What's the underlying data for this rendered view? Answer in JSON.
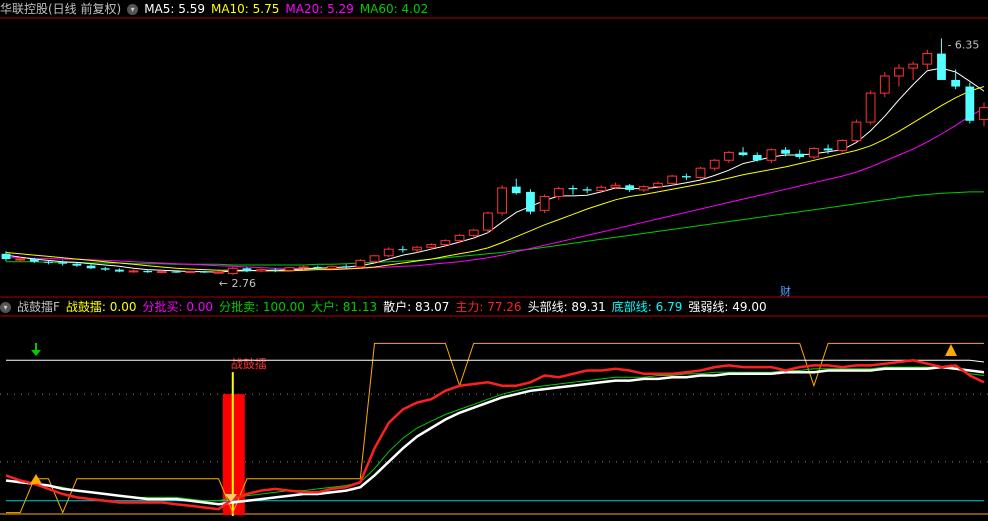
{
  "top_header": {
    "title": "华联控股(日线 前复权)",
    "items": [
      {
        "label": "MA5: 5.59",
        "color": "#ffffff"
      },
      {
        "label": "MA10: 5.75",
        "color": "#ffff00"
      },
      {
        "label": "MA20: 5.29",
        "color": "#ff00ff"
      },
      {
        "label": "MA60: 4.02",
        "color": "#00cc00"
      }
    ]
  },
  "bottom_header": {
    "title": "战鼓擂F",
    "items": [
      {
        "label": "战鼓擂: 0.00",
        "color": "#ffff00"
      },
      {
        "label": "分批买: 0.00",
        "color": "#ff00ff"
      },
      {
        "label": "分批卖: 100.00",
        "color": "#00cc00"
      },
      {
        "label": "大户: 81.13",
        "color": "#00cc00"
      },
      {
        "label": "散户: 83.07",
        "color": "#ffffff"
      },
      {
        "label": "主力: 77.26",
        "color": "#ff2020"
      },
      {
        "label": "头部线: 89.31",
        "color": "#ffffff"
      },
      {
        "label": "底部线: 6.79",
        "color": "#00ffff"
      },
      {
        "label": "强弱线: 49.00",
        "color": "#ffffff"
      }
    ]
  },
  "annotations": {
    "high_label": "6.35",
    "low_label": "2.76",
    "cai_marker": "财",
    "signal_label": "战鼓擂"
  },
  "colors": {
    "up": "#ff3232",
    "down": "#54ffff",
    "ma5": "#ffffff",
    "ma10": "#ffff00",
    "ma20": "#ff00ff",
    "ma60": "#00cc00",
    "panel_border": "#b00000"
  },
  "chart_data": [
    {
      "type": "candlestick",
      "title": "华联控股(日线 前复权)",
      "x": [
        "1",
        "2",
        "3",
        "4",
        "5",
        "6",
        "7",
        "8",
        "9",
        "10",
        "11",
        "12",
        "13",
        "14",
        "15",
        "16",
        "17",
        "18",
        "19",
        "20",
        "21",
        "22",
        "23",
        "24",
        "25",
        "26",
        "27",
        "28",
        "29",
        "30",
        "31",
        "32",
        "33",
        "34",
        "35",
        "36",
        "37",
        "38",
        "39",
        "40",
        "41",
        "42",
        "43",
        "44",
        "45",
        "46",
        "47",
        "48",
        "49",
        "50",
        "51",
        "52",
        "53",
        "54",
        "55",
        "56",
        "57",
        "58",
        "59",
        "60",
        "61",
        "62",
        "63",
        "64",
        "65",
        "66",
        "67",
        "68",
        "69",
        "70"
      ],
      "ohlc": [
        [
          3.08,
          3.12,
          2.97,
          3.0
        ],
        [
          3.0,
          3.04,
          2.96,
          3.0
        ],
        [
          3.0,
          3.02,
          2.94,
          2.96
        ],
        [
          2.96,
          2.98,
          2.92,
          2.95
        ],
        [
          2.95,
          2.98,
          2.9,
          2.93
        ],
        [
          2.93,
          2.95,
          2.88,
          2.9
        ],
        [
          2.9,
          2.92,
          2.85,
          2.86
        ],
        [
          2.86,
          2.88,
          2.82,
          2.84
        ],
        [
          2.84,
          2.86,
          2.8,
          2.81
        ],
        [
          2.81,
          2.84,
          2.79,
          2.82
        ],
        [
          2.82,
          2.84,
          2.79,
          2.8
        ],
        [
          2.8,
          2.83,
          2.79,
          2.81
        ],
        [
          2.81,
          2.83,
          2.79,
          2.8
        ],
        [
          2.8,
          2.82,
          2.79,
          2.81
        ],
        [
          2.81,
          2.82,
          2.79,
          2.8
        ],
        [
          2.8,
          2.82,
          2.79,
          2.8
        ],
        [
          2.78,
          2.88,
          2.76,
          2.86
        ],
        [
          2.86,
          2.88,
          2.8,
          2.82
        ],
        [
          2.82,
          2.86,
          2.8,
          2.84
        ],
        [
          2.84,
          2.86,
          2.8,
          2.83
        ],
        [
          2.83,
          2.88,
          2.82,
          2.87
        ],
        [
          2.87,
          2.9,
          2.84,
          2.88
        ],
        [
          2.88,
          2.9,
          2.85,
          2.86
        ],
        [
          2.86,
          2.9,
          2.84,
          2.89
        ],
        [
          2.89,
          2.92,
          2.86,
          2.88
        ],
        [
          2.88,
          3.0,
          2.86,
          2.98
        ],
        [
          2.96,
          3.06,
          2.94,
          3.05
        ],
        [
          3.05,
          3.18,
          3.03,
          3.15
        ],
        [
          3.15,
          3.2,
          3.1,
          3.14
        ],
        [
          3.14,
          3.2,
          3.1,
          3.18
        ],
        [
          3.18,
          3.24,
          3.14,
          3.22
        ],
        [
          3.22,
          3.3,
          3.18,
          3.28
        ],
        [
          3.28,
          3.38,
          3.24,
          3.36
        ],
        [
          3.36,
          3.46,
          3.3,
          3.44
        ],
        [
          3.44,
          3.72,
          3.4,
          3.7
        ],
        [
          3.7,
          4.12,
          3.66,
          4.08
        ],
        [
          4.1,
          4.22,
          3.98,
          4.0
        ],
        [
          4.02,
          4.06,
          3.68,
          3.72
        ],
        [
          3.74,
          3.98,
          3.7,
          3.95
        ],
        [
          3.95,
          4.1,
          3.9,
          4.07
        ],
        [
          4.08,
          4.12,
          3.98,
          4.06
        ],
        [
          4.06,
          4.1,
          4.0,
          4.04
        ],
        [
          4.04,
          4.12,
          4.02,
          4.09
        ],
        [
          4.09,
          4.16,
          4.06,
          4.12
        ],
        [
          4.12,
          4.14,
          4.02,
          4.05
        ],
        [
          4.05,
          4.12,
          4.02,
          4.1
        ],
        [
          4.1,
          4.18,
          4.08,
          4.15
        ],
        [
          4.15,
          4.28,
          4.12,
          4.26
        ],
        [
          4.26,
          4.3,
          4.2,
          4.24
        ],
        [
          4.24,
          4.4,
          4.22,
          4.38
        ],
        [
          4.38,
          4.52,
          4.34,
          4.5
        ],
        [
          4.5,
          4.64,
          4.46,
          4.62
        ],
        [
          4.62,
          4.7,
          4.56,
          4.58
        ],
        [
          4.58,
          4.62,
          4.48,
          4.5
        ],
        [
          4.5,
          4.68,
          4.46,
          4.66
        ],
        [
          4.66,
          4.7,
          4.56,
          4.6
        ],
        [
          4.6,
          4.66,
          4.52,
          4.55
        ],
        [
          4.55,
          4.7,
          4.52,
          4.68
        ],
        [
          4.68,
          4.74,
          4.6,
          4.65
        ],
        [
          4.65,
          4.82,
          4.62,
          4.8
        ],
        [
          4.8,
          5.12,
          4.78,
          5.08
        ],
        [
          5.08,
          5.56,
          5.04,
          5.52
        ],
        [
          5.52,
          5.84,
          5.46,
          5.78
        ],
        [
          5.78,
          5.96,
          5.62,
          5.9
        ],
        [
          5.9,
          6.0,
          5.72,
          5.96
        ],
        [
          5.96,
          6.18,
          5.88,
          6.12
        ],
        [
          6.12,
          6.35,
          6.02,
          5.72
        ],
        [
          5.72,
          5.88,
          5.58,
          5.62
        ],
        [
          5.62,
          5.68,
          5.06,
          5.1
        ],
        [
          5.12,
          5.38,
          5.02,
          5.3
        ]
      ],
      "ma5": [
        3.06,
        3.03,
        3.0,
        2.98,
        2.96,
        2.95,
        2.93,
        2.91,
        2.89,
        2.86,
        2.84,
        2.83,
        2.82,
        2.81,
        2.81,
        2.8,
        2.82,
        2.82,
        2.83,
        2.83,
        2.84,
        2.85,
        2.86,
        2.87,
        2.88,
        2.9,
        2.94,
        3.0,
        3.06,
        3.1,
        3.15,
        3.2,
        3.26,
        3.32,
        3.4,
        3.56,
        3.71,
        3.8,
        3.89,
        3.96,
        3.96,
        3.97,
        4.02,
        4.08,
        4.07,
        4.07,
        4.09,
        4.12,
        4.16,
        4.2,
        4.27,
        4.35,
        4.45,
        4.5,
        4.55,
        4.58,
        4.58,
        4.6,
        4.63,
        4.66,
        4.77,
        4.95,
        5.17,
        5.42,
        5.65,
        5.86,
        5.9,
        5.84,
        5.7,
        5.55
      ],
      "ma10": [
        3.1,
        3.08,
        3.06,
        3.04,
        3.02,
        3.0,
        2.98,
        2.96,
        2.94,
        2.92,
        2.9,
        2.88,
        2.86,
        2.85,
        2.84,
        2.83,
        2.83,
        2.83,
        2.82,
        2.82,
        2.82,
        2.83,
        2.84,
        2.84,
        2.85,
        2.86,
        2.88,
        2.91,
        2.94,
        2.97,
        3.0,
        3.04,
        3.08,
        3.12,
        3.17,
        3.25,
        3.34,
        3.43,
        3.52,
        3.6,
        3.68,
        3.76,
        3.83,
        3.9,
        3.95,
        3.98,
        4.02,
        4.06,
        4.1,
        4.14,
        4.18,
        4.23,
        4.28,
        4.32,
        4.36,
        4.4,
        4.45,
        4.5,
        4.55,
        4.6,
        4.65,
        4.72,
        4.82,
        4.94,
        5.07,
        5.2,
        5.33,
        5.45,
        5.55,
        5.62
      ],
      "ma20": [
        3.02,
        3.02,
        3.01,
        3.01,
        3.0,
        3.0,
        2.99,
        2.98,
        2.97,
        2.96,
        2.95,
        2.94,
        2.93,
        2.92,
        2.91,
        2.9,
        2.89,
        2.88,
        2.87,
        2.86,
        2.86,
        2.86,
        2.86,
        2.86,
        2.86,
        2.86,
        2.87,
        2.88,
        2.89,
        2.9,
        2.92,
        2.94,
        2.96,
        2.99,
        3.02,
        3.06,
        3.11,
        3.16,
        3.21,
        3.26,
        3.31,
        3.36,
        3.41,
        3.46,
        3.51,
        3.56,
        3.61,
        3.66,
        3.71,
        3.76,
        3.81,
        3.86,
        3.91,
        3.96,
        4.01,
        4.06,
        4.11,
        4.16,
        4.21,
        4.26,
        4.32,
        4.4,
        4.49,
        4.58,
        4.67,
        4.78,
        4.9,
        5.03,
        5.17,
        5.29
      ],
      "ma60": [
        2.96,
        2.96,
        2.96,
        2.95,
        2.95,
        2.95,
        2.94,
        2.94,
        2.94,
        2.93,
        2.93,
        2.93,
        2.92,
        2.92,
        2.92,
        2.92,
        2.91,
        2.91,
        2.91,
        2.91,
        2.91,
        2.91,
        2.92,
        2.92,
        2.93,
        2.94,
        2.95,
        2.96,
        2.97,
        2.98,
        3.0,
        3.02,
        3.04,
        3.06,
        3.08,
        3.1,
        3.13,
        3.15,
        3.18,
        3.21,
        3.24,
        3.27,
        3.3,
        3.33,
        3.36,
        3.39,
        3.42,
        3.45,
        3.48,
        3.51,
        3.54,
        3.57,
        3.6,
        3.63,
        3.66,
        3.69,
        3.72,
        3.75,
        3.78,
        3.81,
        3.84,
        3.87,
        3.9,
        3.93,
        3.96,
        3.98,
        4.0,
        4.01,
        4.02,
        4.02
      ],
      "ylim": [
        2.5,
        6.6
      ]
    },
    {
      "type": "line",
      "title": "战鼓擂F",
      "x_count": 70,
      "ylim": [
        -2,
        115
      ],
      "series": [
        {
          "name": "主力",
          "values": [
            22,
            19,
            17,
            14,
            11,
            9,
            8,
            7,
            6,
            6,
            6,
            6,
            5,
            4,
            3,
            2,
            8,
            11,
            13,
            14,
            13,
            12,
            12,
            14,
            15,
            18,
            38,
            53,
            61,
            65,
            67,
            72,
            75,
            76,
            77,
            75,
            75,
            77,
            81,
            80,
            82,
            84,
            84,
            85,
            84,
            82,
            82,
            82,
            83,
            84,
            86,
            87,
            86,
            86,
            86,
            84,
            86,
            87,
            87,
            86,
            87,
            87,
            88,
            89,
            90,
            88,
            86,
            87,
            81,
            77
          ]
        },
        {
          "name": "大户",
          "values": [
            19,
            18,
            17,
            16,
            15,
            13,
            12,
            11,
            10,
            9,
            9,
            9,
            9,
            8,
            7,
            7,
            9,
            10,
            11,
            12,
            13,
            13,
            14,
            15,
            16,
            18,
            26,
            36,
            44,
            50,
            54,
            58,
            61,
            64,
            67,
            70,
            72,
            74,
            75,
            76,
            77,
            78,
            79,
            80,
            80,
            80,
            81,
            81,
            82,
            82,
            83,
            83,
            83,
            83,
            83,
            84,
            84,
            85,
            85,
            85,
            85,
            85,
            86,
            86,
            86,
            86,
            86,
            85,
            82,
            81
          ]
        },
        {
          "name": "散户",
          "values": [
            19,
            18,
            17,
            16,
            14,
            13,
            12,
            11,
            10,
            9,
            8,
            8,
            8,
            7,
            6,
            5,
            6,
            7,
            8,
            9,
            10,
            11,
            11,
            12,
            13,
            15,
            22,
            30,
            38,
            45,
            50,
            55,
            59,
            62,
            65,
            68,
            70,
            72,
            73,
            74,
            75,
            76,
            77,
            78,
            78,
            79,
            79,
            80,
            80,
            81,
            81,
            82,
            82,
            82,
            82,
            83,
            83,
            83,
            84,
            84,
            84,
            84,
            85,
            85,
            85,
            85,
            86,
            85,
            84,
            83
          ]
        },
        {
          "name": "头部线",
          "values": [
            90,
            90,
            90,
            90,
            90,
            90,
            90,
            90,
            90,
            90,
            90,
            90,
            90,
            90,
            90,
            90,
            90,
            90,
            90,
            90,
            90,
            90,
            90,
            90,
            90,
            90,
            90,
            90,
            90,
            90,
            90,
            90,
            90,
            90,
            90,
            90,
            90,
            90,
            90,
            90,
            90,
            90,
            90,
            90,
            90,
            90,
            90,
            90,
            90,
            90,
            90,
            90,
            90,
            90,
            90,
            90,
            90,
            90,
            90,
            90,
            90,
            90,
            90,
            90,
            90,
            90,
            90,
            90,
            90,
            89
          ]
        },
        {
          "name": "底部线",
          "values": [
            7,
            7,
            7,
            7,
            7,
            7,
            7,
            7,
            7,
            7,
            7,
            7,
            7,
            7,
            7,
            7,
            7,
            7,
            7,
            7,
            7,
            7,
            7,
            7,
            7,
            7,
            7,
            7,
            7,
            7,
            7,
            7,
            7,
            7,
            7,
            7,
            7,
            7,
            7,
            7,
            7,
            7,
            7,
            7,
            7,
            7,
            7,
            7,
            7,
            7,
            7,
            7,
            7,
            7,
            7,
            7,
            7,
            7,
            7,
            7,
            7,
            7,
            7,
            7,
            7,
            7,
            7,
            7,
            7,
            7
          ]
        },
        {
          "name": "强弱线",
          "values": [
            0,
            0,
            20,
            20,
            0,
            20,
            20,
            20,
            20,
            20,
            20,
            20,
            20,
            20,
            20,
            20,
            0,
            20,
            20,
            20,
            20,
            20,
            20,
            20,
            20,
            20,
            100,
            100,
            100,
            100,
            100,
            100,
            75,
            100,
            100,
            100,
            100,
            100,
            100,
            100,
            100,
            100,
            100,
            100,
            100,
            100,
            100,
            100,
            100,
            100,
            100,
            100,
            100,
            100,
            100,
            100,
            100,
            75,
            100,
            100,
            100,
            100,
            100,
            100,
            100,
            100,
            100,
            100,
            100,
            100
          ]
        }
      ],
      "signal": {
        "label": "战鼓擂",
        "index": 16,
        "value": 70
      }
    }
  ]
}
